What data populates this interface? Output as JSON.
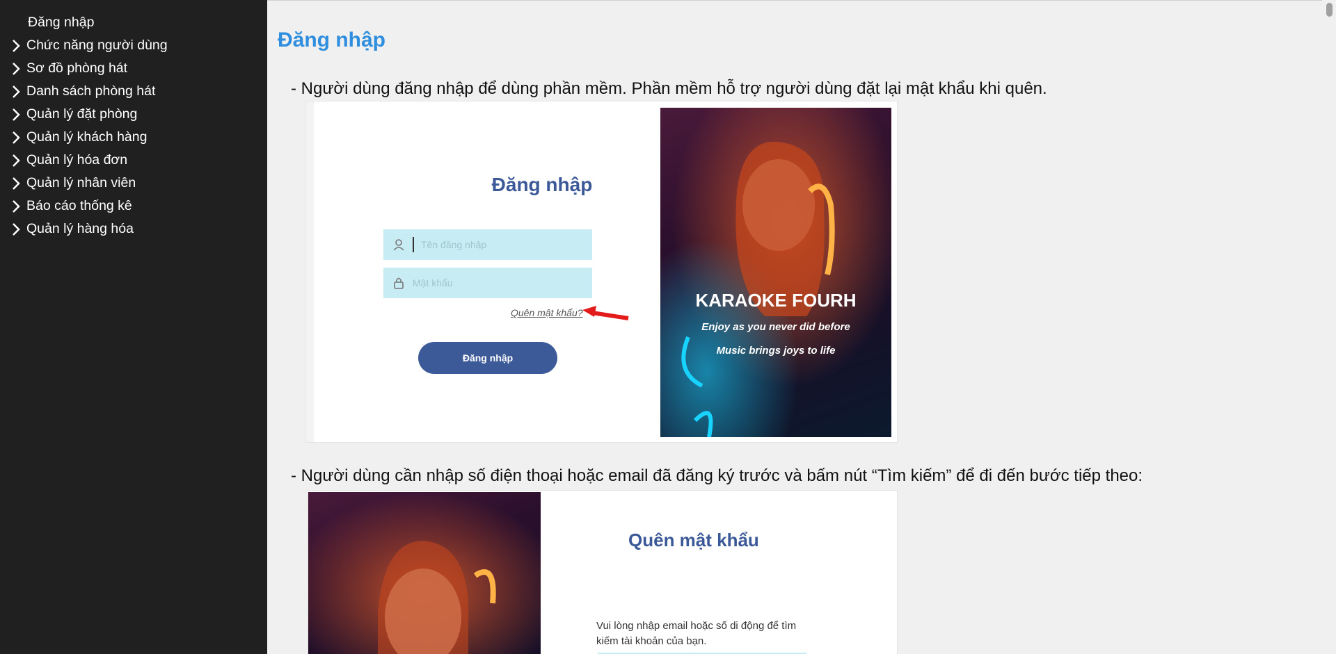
{
  "sidebar": {
    "items": [
      {
        "label": "Đăng nhập",
        "has_chevron": false
      },
      {
        "label": "Chức năng người dùng",
        "has_chevron": true
      },
      {
        "label": "Sơ đồ phòng hát",
        "has_chevron": true
      },
      {
        "label": "Danh sách phòng hát",
        "has_chevron": true
      },
      {
        "label": "Quản lý đặt phòng",
        "has_chevron": true
      },
      {
        "label": "Quản lý khách hàng",
        "has_chevron": true
      },
      {
        "label": "Quản lý hóa đơn",
        "has_chevron": true
      },
      {
        "label": "Quản lý nhân viên",
        "has_chevron": true
      },
      {
        "label": "Báo cáo thống kê",
        "has_chevron": true
      },
      {
        "label": "Quản lý hàng hóa",
        "has_chevron": true
      }
    ]
  },
  "main": {
    "title": "Đăng nhập",
    "paragraph1": "- Người dùng đăng nhập để dùng phần mềm. Phần mềm hỗ trợ người dùng đặt lại mật khẩu khi quên.",
    "paragraph2": "- Người dùng cần nhập số điện thoại hoặc email đã đăng ký trước và bấm nút “Tìm kiếm” để đi đến bước tiếp theo:"
  },
  "screenshot1": {
    "title": "Đăng nhập",
    "username_placeholder": "Tên đăng nhập",
    "password_placeholder": "Mật khẩu",
    "forgot_link": "Quên mật khẩu?",
    "login_button": "Đăng nhập",
    "poster_title": "KARAOKE FOURH",
    "poster_line1": "Enjoy as you never did before",
    "poster_line2": "Music brings joys to life"
  },
  "screenshot2": {
    "title": "Quên mật khẩu",
    "description": "Vui lòng nhập email hoặc số di động để tìm kiếm tài khoản của bạn."
  },
  "colors": {
    "sidebar_bg": "#202020",
    "title_blue": "#2f8ede",
    "button_blue": "#3d5a98",
    "field_bg": "#c8ecf3"
  }
}
